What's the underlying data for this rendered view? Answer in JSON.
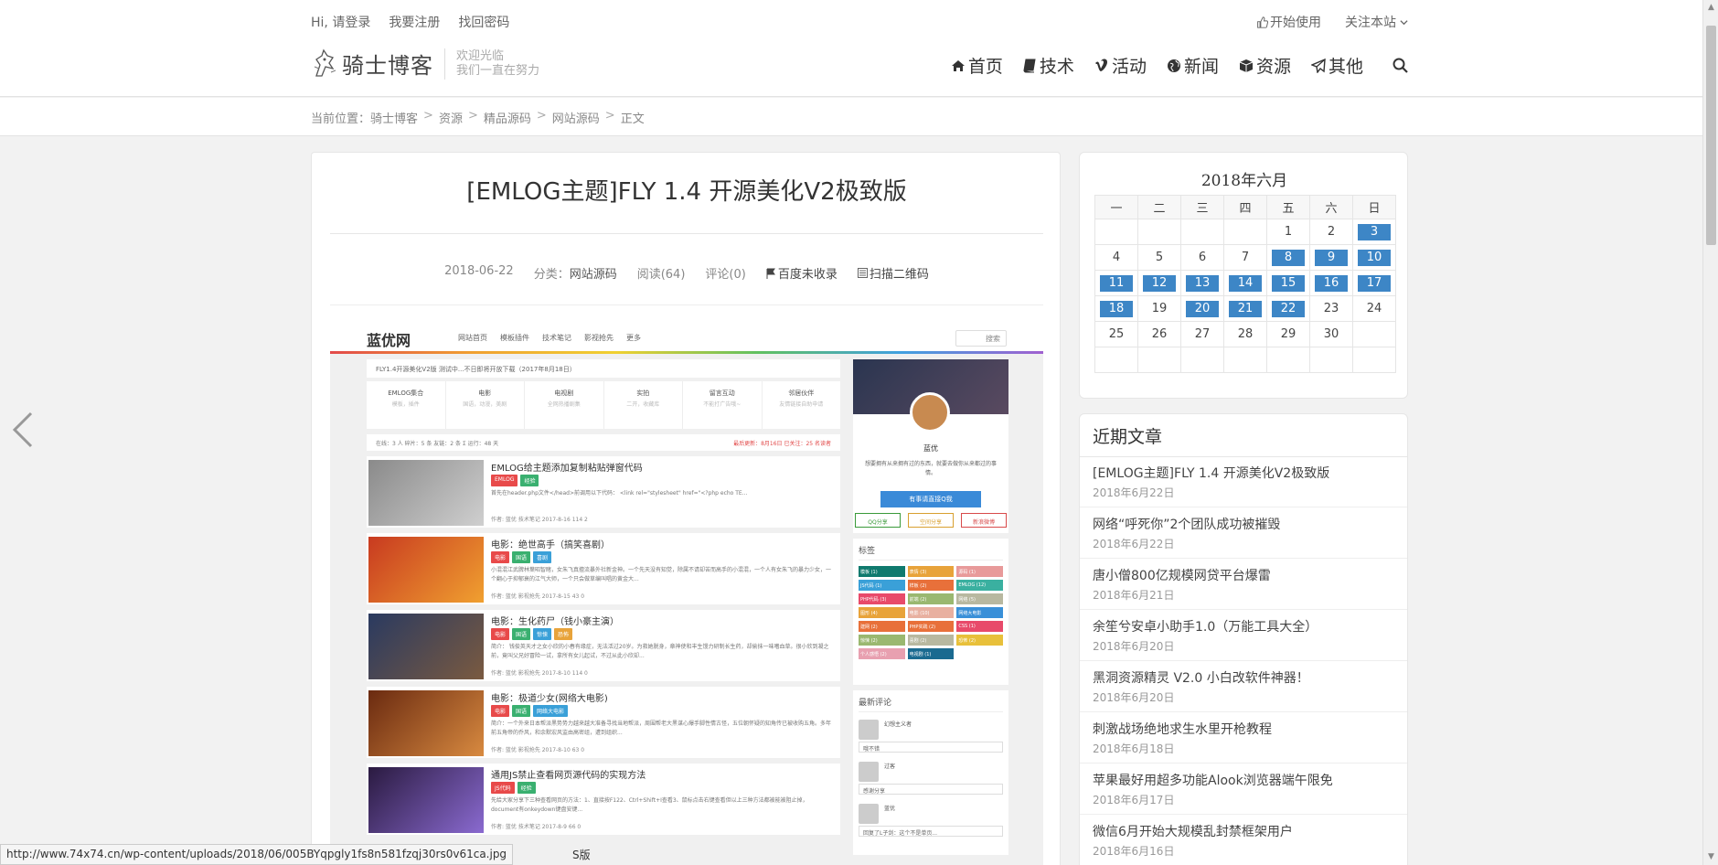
{
  "topbar": {
    "login": "Hi, 请登录",
    "register": "我要注册",
    "recover": "找回密码",
    "start": "开始使用",
    "follow": "关注本站"
  },
  "site": {
    "name": "骑士博客",
    "slogan1": "欢迎光临",
    "slogan2": "我们一直在努力"
  },
  "nav": [
    {
      "label": "首页",
      "icon": "home-icon"
    },
    {
      "label": "技术",
      "icon": "book-icon"
    },
    {
      "label": "活动",
      "icon": "vimeo-icon"
    },
    {
      "label": "新闻",
      "icon": "globe-icon"
    },
    {
      "label": "资源",
      "icon": "cube-icon"
    },
    {
      "label": "其他",
      "icon": "paper-plane-icon"
    }
  ],
  "breadcrumb": {
    "prefix": "当前位置：",
    "items": [
      "骑士博客",
      "资源",
      "精品源码",
      "网站源码",
      "正文"
    ],
    "sep": ">"
  },
  "article": {
    "title": "[EMLOG主题]FLY 1.4 开源美化V2极致版",
    "date": "2018-06-22",
    "category_label": "分类：",
    "category": "网站源码",
    "views": "阅读(64)",
    "comments": "评论(0)",
    "baidu": "百度未收录",
    "qrcode": "扫描二维码"
  },
  "shot": {
    "logo": "蓝优网",
    "nav": [
      "网站首页",
      "模板插件",
      "技术笔记",
      "影视抢先",
      "更多"
    ],
    "search": "搜索",
    "notice": "FLY1.4开源美化V2版 测试中...不日即将开放下载（2017年8月18日）",
    "icons": [
      {
        "t": "EMLOG集合",
        "s": "模板，插件"
      },
      {
        "t": "电影",
        "s": "国语，动漫，美剧"
      },
      {
        "t": "电视剧",
        "s": "全网热播剧集"
      },
      {
        "t": "实拍",
        "s": "二开，收藏库"
      },
      {
        "t": "留言互动",
        "s": "不能打广告哦~"
      },
      {
        "t": "邻居伙伴",
        "s": "友情链接自助申请"
      }
    ],
    "stat": "在线：3 人    碎片：5 条    友链：2 条    Σ 运行：48 天",
    "stat_red": "最后更新：8月16日    已关注：25 名读者",
    "posts": [
      {
        "title": "EMLOG给主题添加复制粘贴弹窗代码",
        "tags": [
          "EMLOG",
          "经验"
        ],
        "desc": "首先在header.php文件</head>前调用以下代码： <link rel=\"stylesheet\" href=\"<?php echo TE...",
        "foot": "作者: 蓝优   技术笔记   2017-8-16   114   2"
      },
      {
        "title": "电影：绝世高手（搞笑喜剧）",
        "tags": [
          "电影",
          "国语",
          "喜剧"
        ],
        "desc": "小混混江武脾林葉昭智睹，女朱飞真擅流暴外社新金神。一个先天没有知觉，除属不请却苦而高手的小混混，一个人有女朱飞的暴力少女，一个翻心于抑郁衰的江气大师，一个只会做草编叫唱的黄金大...",
        "foot": "作者: 蓝优   影视抢先   2017-8-15   43   0"
      },
      {
        "title": "电影：生化药尸（钱小豪主演）",
        "tags": [
          "电影",
          "国语",
          "惊悚",
          "恐怖"
        ],
        "desc": "简介： 钱俊英天才之女小欣的小春有缘症，无法活过20岁。为救她脱身，章神使和丰生馒力研制长生药，却偷抹一味嗜血草。很小欣到凝之前，竟叫父兄好冒险一试，拿所有女儿起试，不过从此小欣却...",
        "foot": "作者: 蓝优   影视抢先   2017-8-10   114   0"
      },
      {
        "title": "电影：极道少女(网络大电影)",
        "tags": [
          "电影",
          "国语",
          "网络大电影"
        ],
        "desc": "简介：一个外来日本帮派黑势势力越来越大准备寻找当地帮派，周围帮老大黑谋心爆手脚性情古怪，五位朝怀疑的知角传已被收购五角。多年前五角帝的乔风，和余默宏风监由高密组，遭到组织...",
        "foot": "作者: 蓝优   影视抢先   2017-8-10   63   0"
      },
      {
        "title": "通用JS禁止查看网页源代码的实现方法",
        "tags": [
          "JS代码",
          "经验"
        ],
        "desc": "先给大家分享下三种查看网页的方法：1、直接按F122、Ctrl+Shift+I查看3、鼠标点击右键查看但以上三种方法都被能被阻止掉，document有onkeydown键盘安键...",
        "foot": "作者: 蓝优   技术笔记   2017-8-9   66   0"
      }
    ],
    "profile_name": "蓝优",
    "profile_bio": "想要拥有从来拥有过的东西，就要去做你从来都过的事情。",
    "qq_btn": "有事请直接Q我",
    "shares": [
      "QQ分享",
      "空间分享",
      "新浪微博"
    ],
    "tags_title": "标签",
    "tags": [
      {
        "t": "模板 (1)",
        "c": "#0f7a6e"
      },
      {
        "t": "表情 (3)",
        "c": "#e8a33a"
      },
      {
        "t": "源码 (1)",
        "c": "#e89a9a"
      },
      {
        "t": "JS代码 (1)",
        "c": "#3aa0d8"
      },
      {
        "t": "样板 (2)",
        "c": "#e8703a"
      },
      {
        "t": "EMLOG (12)",
        "c": "#3ab0a0"
      },
      {
        "t": "PHP代码 (3)",
        "c": "#e84a6a"
      },
      {
        "t": "前端 (2)",
        "c": "#9ab870"
      },
      {
        "t": "网络 (5)",
        "c": "#b8b8a0"
      },
      {
        "t": "图形 (4)",
        "c": "#e8a33a"
      },
      {
        "t": "电影 (10)",
        "c": "#e8b0a0"
      },
      {
        "t": "网络大电影",
        "c": "#3a90d8"
      },
      {
        "t": "建网 (2)",
        "c": "#e8703a"
      },
      {
        "t": "PHP实践 (2)",
        "c": "#e8703a"
      },
      {
        "t": "CSS (1)",
        "c": "#e84a6a"
      },
      {
        "t": "惊悚 (2)",
        "c": "#9ab870"
      },
      {
        "t": "喜剧 (2)",
        "c": "#b8b8a0"
      },
      {
        "t": "恐怖 (2)",
        "c": "#e8c03a"
      },
      {
        "t": "个人感悟 (2)",
        "c": "#e8a0b0"
      },
      {
        "t": "电视剧 (1)",
        "c": "#1a6a90"
      }
    ],
    "comments_title": "最新评论",
    "comments": [
      {
        "n": "幻想主义者",
        "t": "哦不错"
      },
      {
        "n": "过客",
        "t": "感谢分享"
      },
      {
        "n": "蓝优",
        "t": "回复了L子剑：这个不是单页..."
      }
    ]
  },
  "calendar": {
    "title": "2018年六月",
    "weekdays": [
      "一",
      "二",
      "三",
      "四",
      "五",
      "六",
      "日"
    ],
    "weeks": [
      [
        "",
        "",
        "",
        "",
        "1",
        "2",
        "3"
      ],
      [
        "4",
        "5",
        "6",
        "7",
        "8",
        "9",
        "10"
      ],
      [
        "11",
        "12",
        "13",
        "14",
        "15",
        "16",
        "17"
      ],
      [
        "18",
        "19",
        "20",
        "21",
        "22",
        "23",
        "24"
      ],
      [
        "25",
        "26",
        "27",
        "28",
        "29",
        "30",
        ""
      ],
      [
        "",
        "",
        "",
        "",
        "",
        "",
        ""
      ]
    ],
    "highlighted": [
      "3",
      "8",
      "9",
      "10",
      "11",
      "12",
      "13",
      "14",
      "15",
      "16",
      "17",
      "18",
      "20",
      "21",
      "22"
    ],
    "highlight_color": "#3d86c6"
  },
  "recent": {
    "title": "近期文章",
    "items": [
      {
        "t": "[EMLOG主题]FLY 1.4 开源美化V2极致版",
        "d": "2018年6月22日"
      },
      {
        "t": "网络“呼死你”2个团队成功被摧毁",
        "d": "2018年6月22日"
      },
      {
        "t": "唐小僧800亿规模网贷平台爆雷",
        "d": "2018年6月21日"
      },
      {
        "t": "余笙兮安卓小助手1.0（万能工具大全）",
        "d": "2018年6月20日"
      },
      {
        "t": "黑洞资源精灵 V2.0 小白改软件神器！",
        "d": "2018年6月20日"
      },
      {
        "t": "刺激战场绝地求生水里开枪教程",
        "d": "2018年6月18日"
      },
      {
        "t": "苹果最好用超多功能Alook浏览器端午限免",
        "d": "2018年6月17日"
      },
      {
        "t": "微信6月开始大规模乱封禁框架用户",
        "d": "2018年6月16日"
      }
    ]
  },
  "status": {
    "url": "http://www.74x74.cn/wp-content/uploads/2018/06/005BYqpgly1fs8n581fzqj30rs0v61ca.jpg",
    "tail": "S版"
  }
}
